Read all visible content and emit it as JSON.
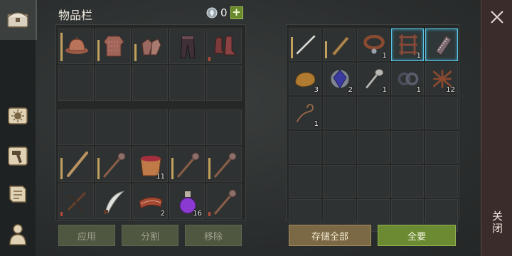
{
  "title": "物品栏",
  "gem_count": "0",
  "plus_label": "+",
  "inventory": {
    "equipment": [
      {
        "icon": "leather-hat-icon",
        "count": ""
      },
      {
        "icon": "chainmail-shirt-icon",
        "count": ""
      },
      {
        "icon": "chainmail-gloves-icon",
        "count": ""
      },
      {
        "icon": "leather-pants-icon",
        "count": ""
      },
      {
        "icon": "leather-boots-icon",
        "count": ""
      }
    ],
    "bag_row1": [
      {
        "icon": "wooden-staff-icon",
        "count": ""
      },
      {
        "icon": "spiked-mace-icon",
        "count": ""
      },
      {
        "icon": "bucket-of-berries-icon",
        "count": "11"
      },
      {
        "icon": "spiked-mace-icon",
        "count": ""
      },
      {
        "icon": "spiked-mace-icon",
        "count": ""
      }
    ],
    "bag_row2": [
      {
        "icon": "crossbow-icon",
        "count": ""
      },
      {
        "icon": "curved-sword-icon",
        "count": ""
      },
      {
        "icon": "bacon-strips-icon",
        "count": "2"
      },
      {
        "icon": "purple-potion-icon",
        "count": "16"
      },
      {
        "icon": "spiked-mace-icon",
        "count": ""
      }
    ],
    "buttons": {
      "apply": "应用",
      "split": "分割",
      "remove": "移除"
    }
  },
  "storage": {
    "row1": [
      {
        "icon": "long-sword-icon",
        "count": ""
      },
      {
        "icon": "broad-sword-icon",
        "count": ""
      },
      {
        "icon": "leather-collar-icon",
        "count": "1"
      },
      {
        "icon": "wooden-frame-icon",
        "count": "1"
      },
      {
        "icon": "bandaged-bracer-icon",
        "count": ""
      }
    ],
    "row2": [
      {
        "icon": "bread-loaf-icon",
        "count": "3"
      },
      {
        "icon": "blue-crystal-icon",
        "count": "2"
      },
      {
        "icon": "iron-spoon-icon",
        "count": "1"
      },
      {
        "icon": "iron-chain-icon",
        "count": "1"
      },
      {
        "icon": "rope-net-icon",
        "count": "12"
      }
    ],
    "row3": [
      {
        "icon": "leather-whip-icon",
        "count": "1"
      }
    ],
    "buttons": {
      "store_all": "存储全部",
      "take_all": "全要"
    }
  },
  "close_label": "关闭",
  "colors": {
    "accent_green": "#6c8a32",
    "selected_border": "#5ec6e6",
    "store_button": "#7b6945"
  }
}
